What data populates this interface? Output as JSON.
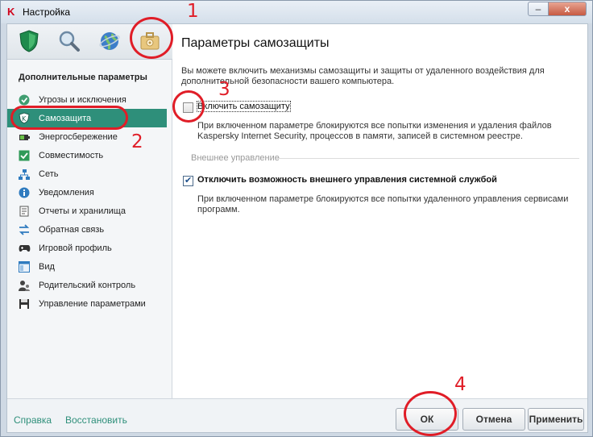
{
  "window": {
    "title": "Настройка",
    "minimize": "–",
    "close": "x"
  },
  "toolbar": {
    "icons": [
      "shield-icon",
      "magnifier-icon",
      "globe-icon",
      "briefcase-gear-icon"
    ]
  },
  "sidebar": {
    "heading": "Дополнительные параметры",
    "items": [
      {
        "label": "Угрозы и исключения",
        "icon": "check-circle-icon"
      },
      {
        "label": "Самозащита",
        "icon": "k-shield-icon",
        "active": true
      },
      {
        "label": "Энергосбережение",
        "icon": "battery-icon"
      },
      {
        "label": "Совместимость",
        "icon": "check-box-icon"
      },
      {
        "label": "Сеть",
        "icon": "network-icon"
      },
      {
        "label": "Уведомления",
        "icon": "info-icon"
      },
      {
        "label": "Отчеты и хранилища",
        "icon": "report-icon"
      },
      {
        "label": "Обратная связь",
        "icon": "arrows-icon"
      },
      {
        "label": "Игровой профиль",
        "icon": "gamepad-icon"
      },
      {
        "label": "Вид",
        "icon": "view-icon"
      },
      {
        "label": "Родительский контроль",
        "icon": "parent-icon"
      },
      {
        "label": "Управление параметрами",
        "icon": "settings-icon"
      }
    ]
  },
  "main": {
    "title": "Параметры самозащиты",
    "description": "Вы можете включить механизмы самозащиты и защиты от удаленного воздействия для дополнительной безопасности вашего компьютера.",
    "self_protection": {
      "label": "Включить самозащиту",
      "checked": false,
      "description": "При включенном параметре блокируются все попытки изменения и удаления файлов Kaspersky Internet Security, процессов в памяти, записей в системном реестре."
    },
    "external_group": "Внешнее управление",
    "external_control": {
      "label": "Отключить возможность внешнего управления системной службой",
      "checked": true,
      "description": "При включенном параметре блокируются все попытки удаленного управления сервисами программ."
    }
  },
  "footer": {
    "help": "Справка",
    "restore": "Восстановить",
    "ok": "ОК",
    "cancel": "Отмена",
    "apply": "Применить"
  },
  "annotations": [
    "1",
    "2",
    "3",
    "4"
  ],
  "colors": {
    "accent": "#2e8f7a",
    "annotation": "#e01d27"
  }
}
